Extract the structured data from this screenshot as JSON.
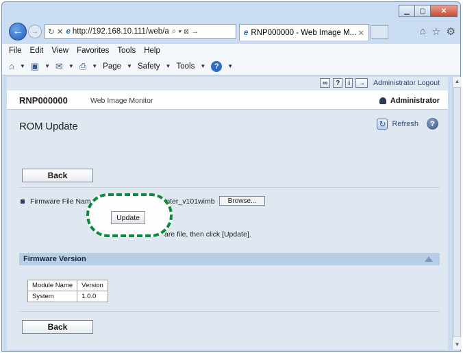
{
  "browser": {
    "address_url": "http://192.168.10.111/web/a",
    "address_suffix": "⌕ ▾ ⊠ →",
    "tab_title": "RNP000000 - Web Image M...",
    "menu": [
      "File",
      "Edit",
      "View",
      "Favorites",
      "Tools",
      "Help"
    ],
    "command_bar": {
      "page": "Page",
      "safety": "Safety",
      "tools": "Tools"
    }
  },
  "header": {
    "logout": "Administrator Logout",
    "device": "RNP000000",
    "app_name": "Web Image Monitor",
    "user": "Administrator"
  },
  "page": {
    "title": "ROM Update",
    "refresh": "Refresh",
    "back_label": "Back",
    "firmware_label": "Firmware File Nam",
    "file_value": "inter_v101wimb",
    "browse_label": "Browse...",
    "update_label": "Update",
    "hint": "are file, then click [Update]."
  },
  "section": {
    "title": "Firmware Version",
    "table_headers": [
      "Module Name",
      "Version"
    ],
    "rows": [
      [
        "System",
        "1.0.0"
      ]
    ]
  }
}
